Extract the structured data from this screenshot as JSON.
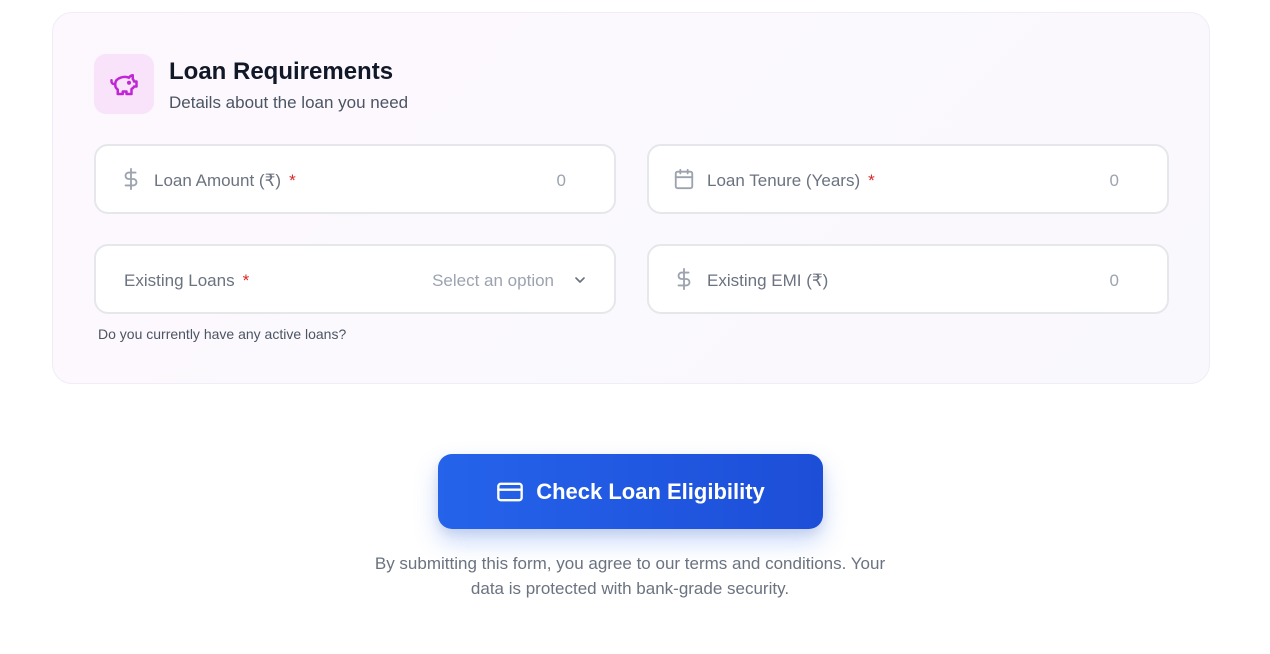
{
  "section": {
    "icon": "piggy-bank-icon",
    "title": "Loan Requirements",
    "subtitle": "Details about the loan you need"
  },
  "fields": {
    "loan_amount": {
      "icon": "dollar-icon",
      "label": "Loan Amount (₹)",
      "required_mark": "*",
      "value": "0"
    },
    "loan_tenure": {
      "icon": "calendar-icon",
      "label": "Loan Tenure (Years)",
      "required_mark": "*",
      "value": "0"
    },
    "existing_loans": {
      "label": "Existing Loans",
      "required_mark": "*",
      "selected": "Select an option",
      "icon": "chevron-down-icon",
      "hint": "Do you currently have any active loans?"
    },
    "existing_emi": {
      "icon": "dollar-icon",
      "label": "Existing EMI (₹)",
      "value": "0"
    }
  },
  "submit": {
    "icon": "credit-card-icon",
    "label": "Check Loan Eligibility"
  },
  "terms": {
    "line1": "By submitting this form, you agree to our terms and conditions. Your",
    "line2": "data is protected with bank-grade security."
  },
  "colors": {
    "accent": "#2563eb",
    "icon_accent": "#c026d3",
    "required": "#dc2626"
  }
}
